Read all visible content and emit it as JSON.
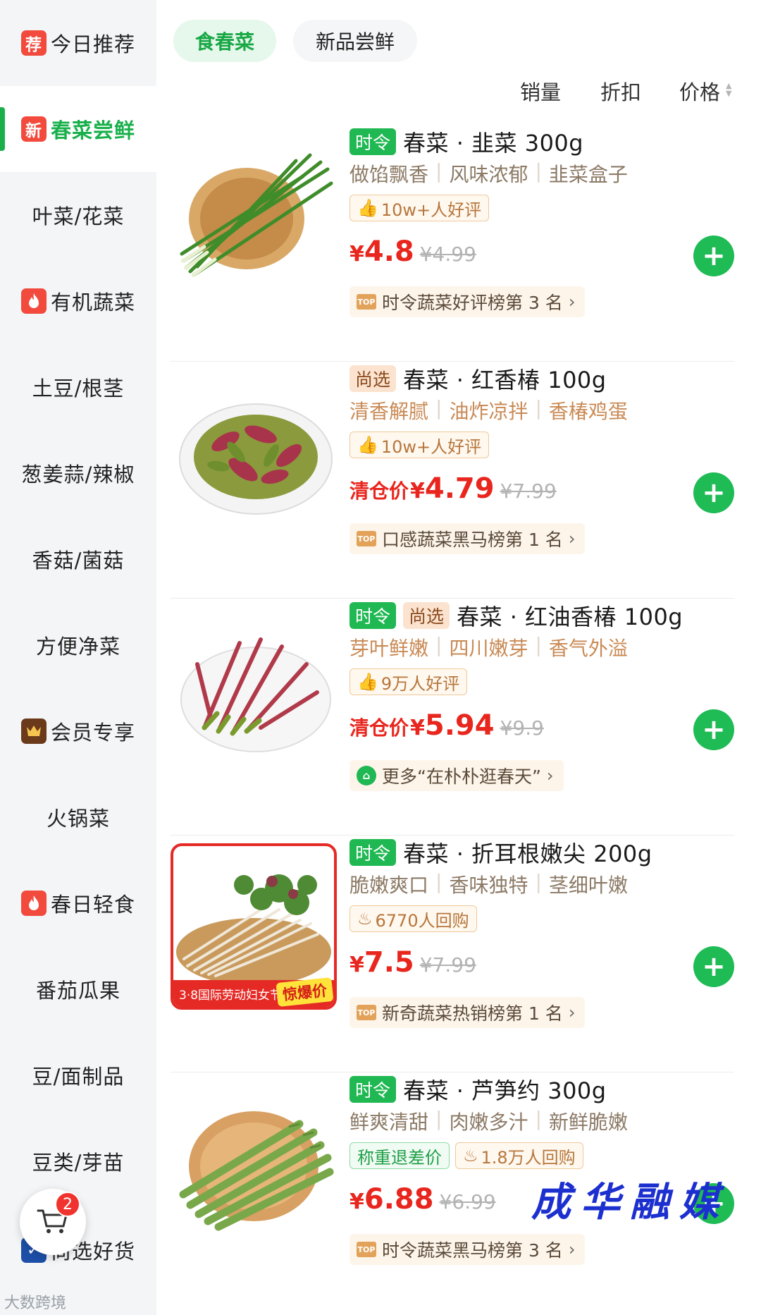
{
  "sidebar": {
    "items": [
      {
        "label": "今日推荐",
        "badge": "荐",
        "badge_color": "#f24b3e"
      },
      {
        "label": "春菜尝鲜",
        "badge": "新",
        "badge_color": "#f24b3e",
        "active": true
      },
      {
        "label": "叶菜/花菜"
      },
      {
        "label": "有机蔬菜",
        "badge": "fire-icon",
        "badge_color": "#f24b3e"
      },
      {
        "label": "土豆/根茎"
      },
      {
        "label": "葱姜蒜/辣椒"
      },
      {
        "label": "香菇/菌菇"
      },
      {
        "label": "方便净菜"
      },
      {
        "label": "会员专享",
        "badge": "crown-icon",
        "badge_color": "#6b3a1a"
      },
      {
        "label": "火锅菜"
      },
      {
        "label": "春日轻食",
        "badge": "fire-icon",
        "badge_color": "#f24b3e"
      },
      {
        "label": "番茄瓜果"
      },
      {
        "label": "豆/面制品"
      },
      {
        "label": "豆类/芽苗"
      },
      {
        "label": "尚选好货"
      }
    ],
    "cart_count": "2",
    "footer_logo": "大数跨境"
  },
  "tabs": {
    "active": "食春菜",
    "other": "新品尝鲜"
  },
  "sort": {
    "sales": "销量",
    "discount": "折扣",
    "price": "价格"
  },
  "colors": {
    "accent": "#1fbb55",
    "price": "#e8261e"
  },
  "products": [
    {
      "tags": [
        "时令"
      ],
      "title": "春菜 · 韭菜 300g",
      "features": [
        "做馅飘香",
        "风味浓郁",
        "韭菜盒子"
      ],
      "badges": [
        {
          "text": "10w+人好评",
          "icon": "thumb-up-icon"
        }
      ],
      "price_prefix": "",
      "price": "4.8",
      "original_price": "¥4.99",
      "rank": "时令蔬菜好评榜第 3 名",
      "rank_icon": "TOP",
      "image": "chives-on-bamboo-plate"
    },
    {
      "tags": [
        "尚选"
      ],
      "title": "春菜 · 红香椿 100g",
      "features": [
        "清香解腻",
        "油炸凉拌",
        "香椿鸡蛋"
      ],
      "badges": [
        {
          "text": "10w+人好评",
          "icon": "thumb-up-icon"
        }
      ],
      "price_prefix": "清仓价",
      "price": "4.79",
      "original_price": "¥7.99",
      "rank": "口感蔬菜黑马榜第 1 名",
      "rank_icon": "TOP",
      "image": "red-toona-on-plate"
    },
    {
      "tags": [
        "时令",
        "尚选"
      ],
      "title": "春菜 · 红油香椿 100g",
      "features": [
        "芽叶鲜嫩",
        "四川嫩芽",
        "香气外溢"
      ],
      "badges": [
        {
          "text": "9万人好评",
          "icon": "thumb-up-icon"
        }
      ],
      "price_prefix": "清仓价",
      "price": "5.94",
      "original_price": "¥9.9",
      "rank": "更多“在朴朴逛春天”",
      "rank_icon": "basket",
      "image": "red-oil-toona-on-plate"
    },
    {
      "tags": [
        "时令"
      ],
      "title": "春菜 · 折耳根嫩尖 200g",
      "features": [
        "脆嫩爽口",
        "香味独特",
        "茎细叶嫩"
      ],
      "badges": [
        {
          "text": "6770人回购",
          "icon": "flame-icon"
        }
      ],
      "price_prefix": "",
      "price": "7.5",
      "original_price": "¥7.99",
      "rank": "新奇蔬菜热销榜第 1 名",
      "rank_icon": "TOP",
      "image": "houttuynia-in-basket",
      "promo_strip": "3·8国际劳动妇女节",
      "promo_tag": "惊爆价"
    },
    {
      "tags": [
        "时令"
      ],
      "title": "春菜 · 芦笋约 300g",
      "features": [
        "鲜爽清甜",
        "肉嫩多汁",
        "新鲜脆嫩"
      ],
      "badges": [
        {
          "text": "称重退差价",
          "style": "green"
        },
        {
          "text": "1.8万人回购",
          "icon": "flame-icon"
        }
      ],
      "price_prefix": "",
      "price": "6.88",
      "original_price": "¥6.99",
      "rank": "时令蔬菜黑马榜第 3 名",
      "rank_icon": "TOP",
      "image": "asparagus-on-wood-plate"
    }
  ],
  "watermark": "成华融媒"
}
